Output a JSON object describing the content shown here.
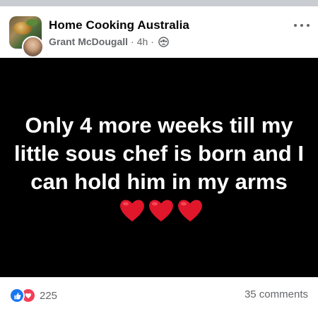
{
  "post": {
    "group_name": "Home Cooking Australia",
    "author": "Grant McDougall",
    "separator": "·",
    "time": "4h",
    "privacy_icon": "group-members-icon",
    "text": "Only 4 more weeks till my little sous chef is born and I can hold him in my arms",
    "emoji": [
      "red-heart",
      "red-heart",
      "red-heart"
    ],
    "background_color": "#000000",
    "text_color": "#ffffff"
  },
  "footer": {
    "reaction_icons": [
      "like-icon",
      "love-icon"
    ],
    "reaction_count": "225",
    "comments": "35 comments"
  },
  "colors": {
    "like": "#1877f2",
    "love": "#f33e58",
    "heart": "#e0162b",
    "secondary_text": "#65676b"
  }
}
